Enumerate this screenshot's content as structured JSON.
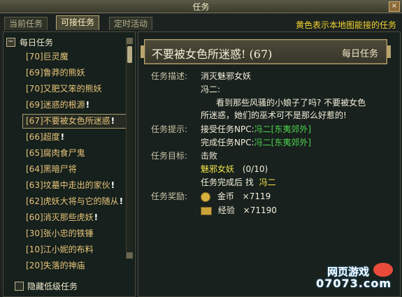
{
  "window": {
    "title": "任务",
    "close_label": "×"
  },
  "tabs": [
    {
      "label": "当前任务"
    },
    {
      "label": "可接任务"
    },
    {
      "label": "定时活动"
    }
  ],
  "hint": "黄色表示本地图能接的任务",
  "category": {
    "toggle": "−",
    "label": "每日任务"
  },
  "quests": [
    {
      "text": "[70]巨灵魔",
      "bang": ""
    },
    {
      "text": "[69]鲁莽的熊妖",
      "bang": ""
    },
    {
      "text": "[70]又肥又笨的熊妖",
      "bang": ""
    },
    {
      "text": "[69]迷惑的根源",
      "bang": "!"
    },
    {
      "text": "[67]不要被女色所迷惑",
      "bang": "!"
    },
    {
      "text": "[66]超度",
      "bang": "!"
    },
    {
      "text": "[65]腐肉食尸鬼",
      "bang": ""
    },
    {
      "text": "[64]黑暗尸将",
      "bang": ""
    },
    {
      "text": "[63]坟墓中走出的家伙",
      "bang": "!"
    },
    {
      "text": "[62]虎妖大将与它的随从",
      "bang": "!"
    },
    {
      "text": "[60]消灭那些虎妖",
      "bang": "!"
    },
    {
      "text": "[30]张小忠的铁锤",
      "bang": ""
    },
    {
      "text": "[10]江小妮的布料",
      "bang": ""
    },
    {
      "text": "[20]失落的神庙",
      "bang": ""
    }
  ],
  "hide_low": "隐藏低级任务",
  "detail": {
    "title": "不要被女色所迷惑! (67)",
    "type": "每日任务",
    "desc_label": "任务描述:",
    "desc_title": "消灭魅邪女妖",
    "npc_name": "冯二:",
    "desc_line1": "看到那些风骚的小娘子了吗? 不要被女色",
    "desc_line2": "所迷惑，她们的巫术可不是那么好惹的!",
    "tip_label": "任务提示:",
    "accept_prefix": "接受任务NPC:",
    "accept_npc": "冯二[东夷郊外]",
    "complete_prefix": "完成任务NPC:",
    "complete_npc": "冯二[东夷郊外]",
    "goal_label": "任务目标:",
    "goal_verb": "击败",
    "goal_target": "魅邪女妖",
    "goal_progress": "(0/10)",
    "goal_after": "任务完成后 找",
    "goal_npc": "冯二",
    "reward_label": "任务奖励:",
    "gold_label": "金币",
    "gold_value": "×7119",
    "exp_label": "经验",
    "exp_value": "×71190"
  },
  "logo": {
    "top": "网页游戏",
    "bottom": "07073.com"
  }
}
